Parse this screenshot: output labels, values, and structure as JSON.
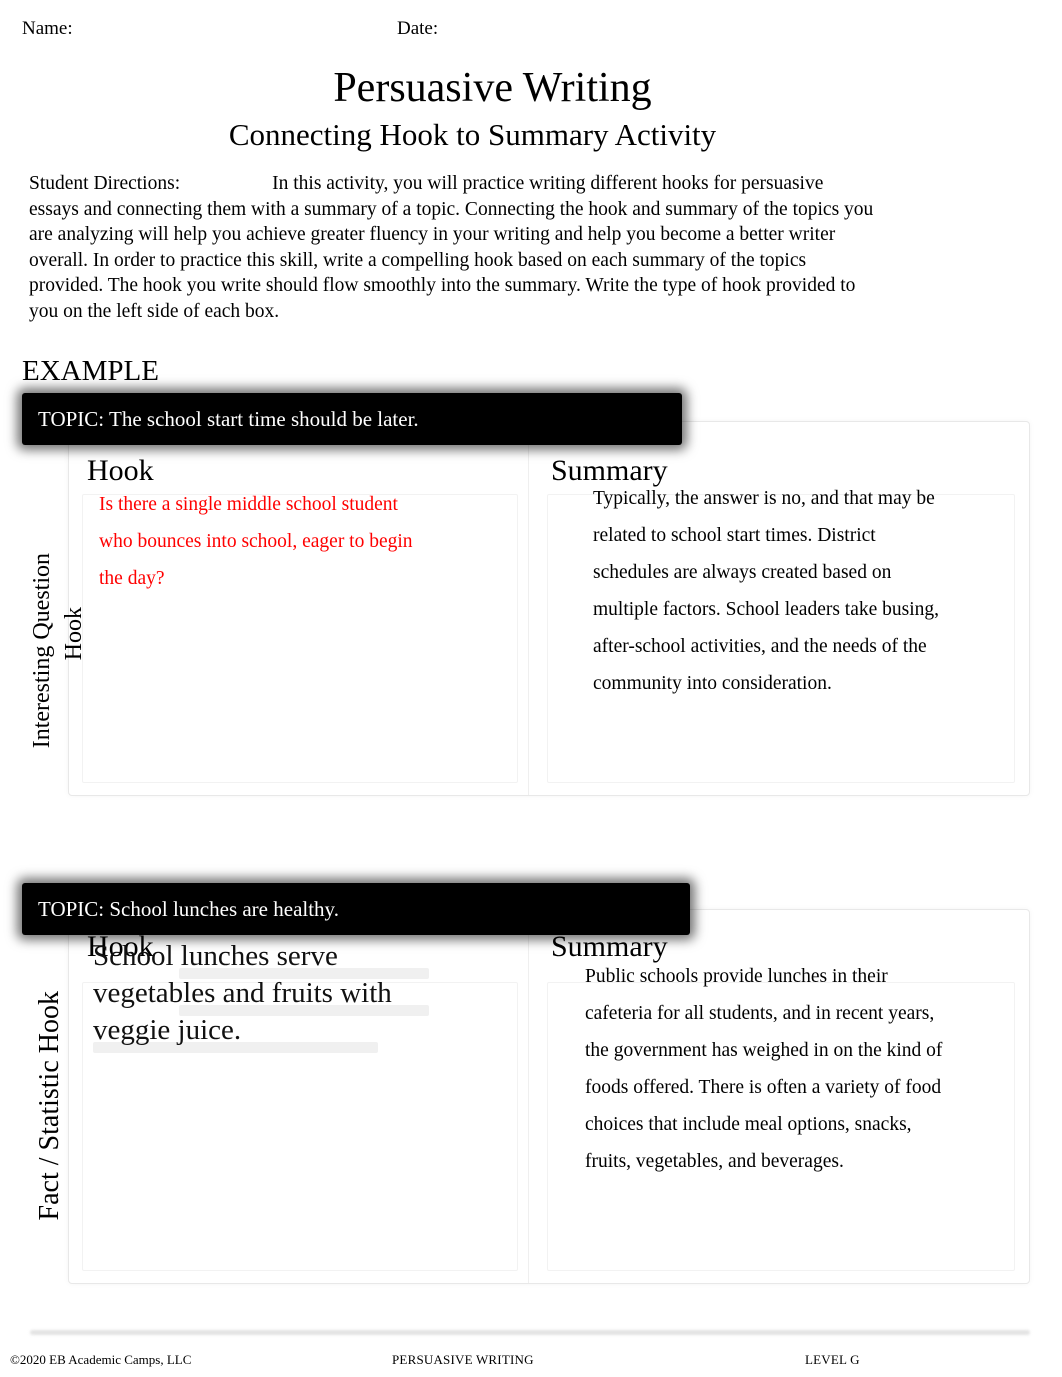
{
  "header": {
    "name_label": "Name:",
    "date_label": "Date:",
    "title": "Persuasive Writing",
    "subtitle": "Connecting Hook to Summary Activity"
  },
  "directions": {
    "label": "Student Directions:",
    "text": "In this activity, you will practice writing different hooks for persuasive essays and connecting them with a summary of a topic. Connecting the hook and summary of the topics you are analyzing will help you achieve greater fluency in your writing and help you become a better writer overall. In order to practice this skill, write a compelling hook based on each summary of the topics provided. The hook you write should flow smoothly into the summary. Write the type of hook provided to you on the left side of each box."
  },
  "example_heading": "EXAMPLE",
  "sections": [
    {
      "topic": "TOPIC: The school start time should be later.",
      "side_label_line1": "Interesting Question",
      "side_label_line2": "Hook",
      "hook_title": "Hook",
      "summary_title": "Summary",
      "hook_text": "Is there a single middle school student who bounces into school, eager to begin the day?",
      "hook_text_color": "#ff0000",
      "summary_text": "Typically, the answer is no, and that may be related to school start times. District schedules are always created based on multiple factors. School leaders take busing, after-school activities, and the needs of the community into consideration."
    },
    {
      "topic": "TOPIC: School lunches are healthy.",
      "side_label_line1": "Fact / Statistic Hook",
      "hook_title": "Hook",
      "summary_title": "Summary",
      "hook_text": "School lunches serve vegetables and fruits with veggie juice.",
      "hook_text_color": "#111111",
      "summary_text": "Public schools provide lunches in their cafeteria for all students, and in recent years, the government has weighed in on the kind of foods offered. There is often a variety of food choices that include meal options, snacks, fruits, vegetables, and beverages."
    }
  ],
  "footer": {
    "copyright": "©2020 EB Academic Camps, LLC",
    "center": "PERSUASIVE WRITING",
    "level": "LEVEL G"
  }
}
